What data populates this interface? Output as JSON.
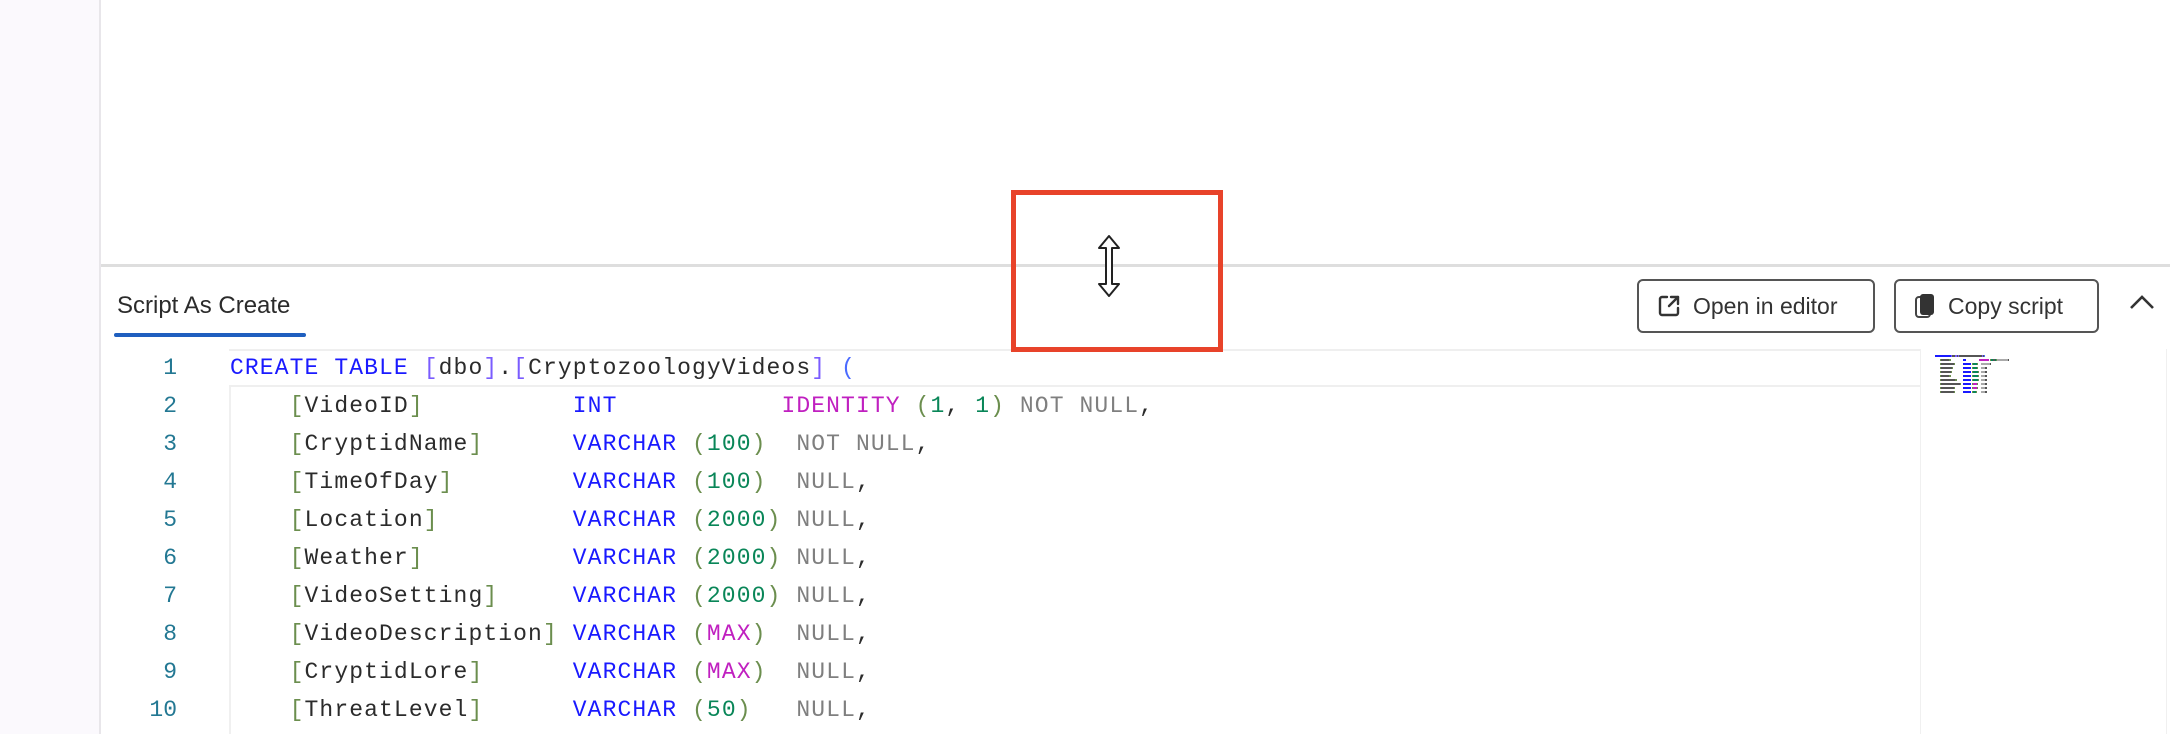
{
  "panel": {
    "tab_label": "Script As Create",
    "open_in_editor_label": "Open in editor",
    "copy_script_label": "Copy script"
  },
  "colors": {
    "accent": "#1f5fbf",
    "highlight_box": "#e8432a",
    "keyword": "#1a1aff",
    "number": "#098658",
    "function": "#c020c0"
  },
  "icons": {
    "open": "external-link-icon",
    "copy": "copy-icon",
    "collapse": "chevron-up-icon",
    "cursor": "resize-vertical-cursor-icon"
  },
  "code": {
    "line_numbers": [
      "1",
      "2",
      "3",
      "4",
      "5",
      "6",
      "7",
      "8",
      "9",
      "10"
    ],
    "lines": [
      [
        [
          "kw",
          "CREATE TABLE "
        ],
        [
          "br1",
          "["
        ],
        [
          "id",
          "dbo"
        ],
        [
          "br1",
          "]"
        ],
        [
          "id",
          "."
        ],
        [
          "br1",
          "["
        ],
        [
          "id",
          "CryptozoologyVideos"
        ],
        [
          "br1",
          "]"
        ],
        [
          "id",
          " "
        ],
        [
          "pb",
          "("
        ]
      ],
      [
        [
          "ws",
          "    "
        ],
        [
          "br",
          "["
        ],
        [
          "id",
          "VideoID"
        ],
        [
          "br",
          "]"
        ],
        [
          "ws",
          "          "
        ],
        [
          "kw",
          "INT"
        ],
        [
          "ws",
          "           "
        ],
        [
          "fn",
          "IDENTITY"
        ],
        [
          "ws",
          " "
        ],
        [
          "br",
          "("
        ],
        [
          "num",
          "1"
        ],
        [
          "id",
          ", "
        ],
        [
          "num",
          "1"
        ],
        [
          "br",
          ")"
        ],
        [
          "gray",
          " NOT NULL"
        ],
        [
          "id",
          ","
        ]
      ],
      [
        [
          "ws",
          "    "
        ],
        [
          "br",
          "["
        ],
        [
          "id",
          "CryptidName"
        ],
        [
          "br",
          "]"
        ],
        [
          "ws",
          "      "
        ],
        [
          "kw",
          "VARCHAR"
        ],
        [
          "ws",
          " "
        ],
        [
          "br",
          "("
        ],
        [
          "num",
          "100"
        ],
        [
          "br",
          ")"
        ],
        [
          "ws",
          "  "
        ],
        [
          "gray",
          "NOT NULL"
        ],
        [
          "id",
          ","
        ]
      ],
      [
        [
          "ws",
          "    "
        ],
        [
          "br",
          "["
        ],
        [
          "id",
          "TimeOfDay"
        ],
        [
          "br",
          "]"
        ],
        [
          "ws",
          "        "
        ],
        [
          "kw",
          "VARCHAR"
        ],
        [
          "ws",
          " "
        ],
        [
          "br",
          "("
        ],
        [
          "num",
          "100"
        ],
        [
          "br",
          ")"
        ],
        [
          "ws",
          "  "
        ],
        [
          "gray",
          "NULL"
        ],
        [
          "id",
          ","
        ]
      ],
      [
        [
          "ws",
          "    "
        ],
        [
          "br",
          "["
        ],
        [
          "id",
          "Location"
        ],
        [
          "br",
          "]"
        ],
        [
          "ws",
          "         "
        ],
        [
          "kw",
          "VARCHAR"
        ],
        [
          "ws",
          " "
        ],
        [
          "br",
          "("
        ],
        [
          "num",
          "2000"
        ],
        [
          "br",
          ")"
        ],
        [
          "ws",
          " "
        ],
        [
          "gray",
          "NULL"
        ],
        [
          "id",
          ","
        ]
      ],
      [
        [
          "ws",
          "    "
        ],
        [
          "br",
          "["
        ],
        [
          "id",
          "Weather"
        ],
        [
          "br",
          "]"
        ],
        [
          "ws",
          "          "
        ],
        [
          "kw",
          "VARCHAR"
        ],
        [
          "ws",
          " "
        ],
        [
          "br",
          "("
        ],
        [
          "num",
          "2000"
        ],
        [
          "br",
          ")"
        ],
        [
          "ws",
          " "
        ],
        [
          "gray",
          "NULL"
        ],
        [
          "id",
          ","
        ]
      ],
      [
        [
          "ws",
          "    "
        ],
        [
          "br",
          "["
        ],
        [
          "id",
          "VideoSetting"
        ],
        [
          "br",
          "]"
        ],
        [
          "ws",
          "     "
        ],
        [
          "kw",
          "VARCHAR"
        ],
        [
          "ws",
          " "
        ],
        [
          "br",
          "("
        ],
        [
          "num",
          "2000"
        ],
        [
          "br",
          ")"
        ],
        [
          "ws",
          " "
        ],
        [
          "gray",
          "NULL"
        ],
        [
          "id",
          ","
        ]
      ],
      [
        [
          "ws",
          "    "
        ],
        [
          "br",
          "["
        ],
        [
          "id",
          "VideoDescription"
        ],
        [
          "br",
          "]"
        ],
        [
          "ws",
          " "
        ],
        [
          "kw",
          "VARCHAR"
        ],
        [
          "ws",
          " "
        ],
        [
          "br",
          "("
        ],
        [
          "fn",
          "MAX"
        ],
        [
          "br",
          ")"
        ],
        [
          "ws",
          "  "
        ],
        [
          "gray",
          "NULL"
        ],
        [
          "id",
          ","
        ]
      ],
      [
        [
          "ws",
          "    "
        ],
        [
          "br",
          "["
        ],
        [
          "id",
          "CryptidLore"
        ],
        [
          "br",
          "]"
        ],
        [
          "ws",
          "      "
        ],
        [
          "kw",
          "VARCHAR"
        ],
        [
          "ws",
          " "
        ],
        [
          "br",
          "("
        ],
        [
          "fn",
          "MAX"
        ],
        [
          "br",
          ")"
        ],
        [
          "ws",
          "  "
        ],
        [
          "gray",
          "NULL"
        ],
        [
          "id",
          ","
        ]
      ],
      [
        [
          "ws",
          "    "
        ],
        [
          "br",
          "["
        ],
        [
          "id",
          "ThreatLevel"
        ],
        [
          "br",
          "]"
        ],
        [
          "ws",
          "      "
        ],
        [
          "kw",
          "VARCHAR"
        ],
        [
          "ws",
          " "
        ],
        [
          "br",
          "("
        ],
        [
          "num",
          "50"
        ],
        [
          "br",
          ")"
        ],
        [
          "ws",
          "   "
        ],
        [
          "gray",
          "NULL"
        ],
        [
          "id",
          ","
        ]
      ]
    ]
  }
}
